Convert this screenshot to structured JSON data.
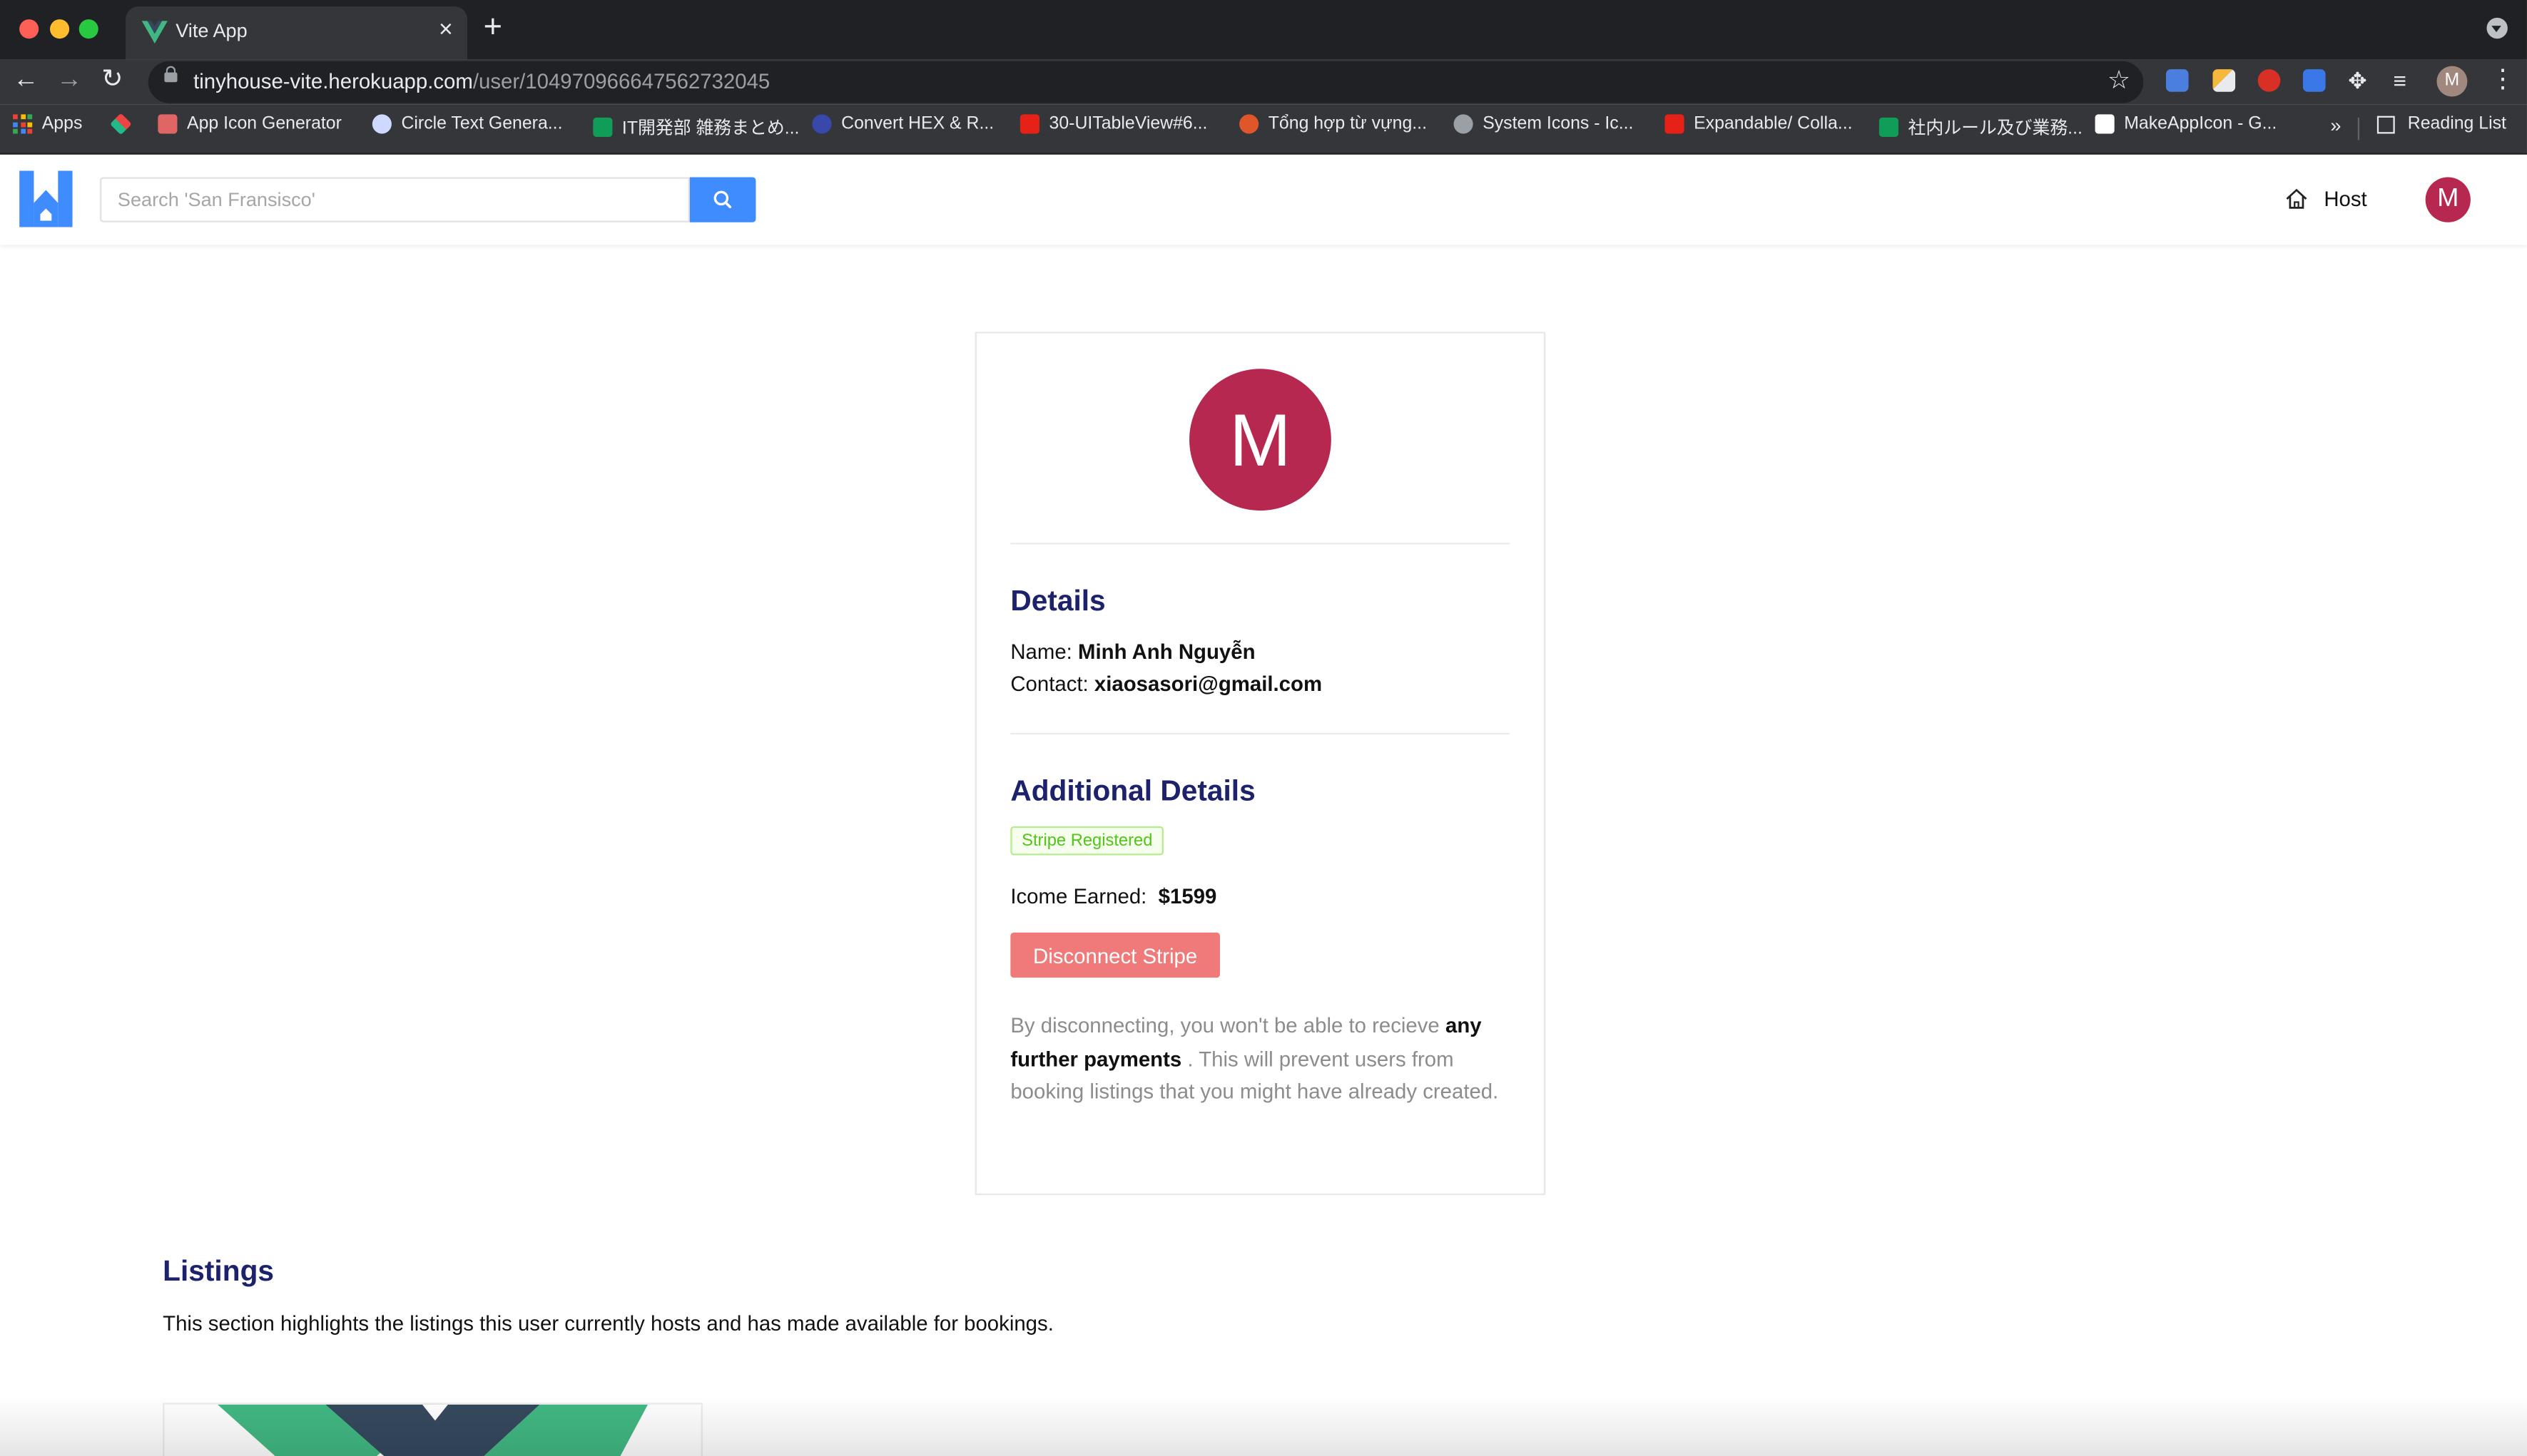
{
  "browser": {
    "tab_title": "Vite App",
    "url_host": "tinyhouse-vite.herokuapp.com",
    "url_path": "/user/104970966647562732045",
    "profile_initial": "M",
    "bookmarks": [
      {
        "label": "Apps"
      },
      {
        "label": ""
      },
      {
        "label": "App Icon Generator"
      },
      {
        "label": "Circle Text Genera..."
      },
      {
        "label": "IT開発部 雑務まとめ..."
      },
      {
        "label": "Convert HEX & R..."
      },
      {
        "label": "30-UITableView#6..."
      },
      {
        "label": "Tổng hợp từ vựng..."
      },
      {
        "label": "System Icons - Ic..."
      },
      {
        "label": "Expandable/ Colla..."
      },
      {
        "label": "社内ルール及び業務..."
      },
      {
        "label": "MakeAppIcon - G..."
      }
    ],
    "bookmarks_overflow": "»",
    "reading_list": "Reading List"
  },
  "header": {
    "search_placeholder": "Search 'San Fransisco'",
    "host_label": "Host",
    "avatar_initial": "M"
  },
  "profile": {
    "avatar_initial": "M",
    "details_title": "Details",
    "name_label": "Name:",
    "name_value": "Minh Anh Nguyễn",
    "contact_label": "Contact:",
    "contact_value": "xiaosasori@gmail.com",
    "additional_title": "Additional Details",
    "stripe_tag": "Stripe Registered",
    "income_label": "Icome Earned:",
    "income_value": "$1599",
    "disconnect_button": "Disconnect Stripe",
    "note_part1": "By disconnecting, you won't be able to recieve",
    "note_bold": "any further payments",
    "note_part2": ". This will prevent users from booking listings that you might have already created."
  },
  "listings": {
    "title": "Listings",
    "description": "This section highlights the listings this user currently hosts and has made available for bookings."
  },
  "colors": {
    "brand_blue": "#3f8cff",
    "heading_navy": "#1d226c",
    "avatar": "#b6284f",
    "danger": "#f07a79",
    "success": "#52c41a"
  }
}
